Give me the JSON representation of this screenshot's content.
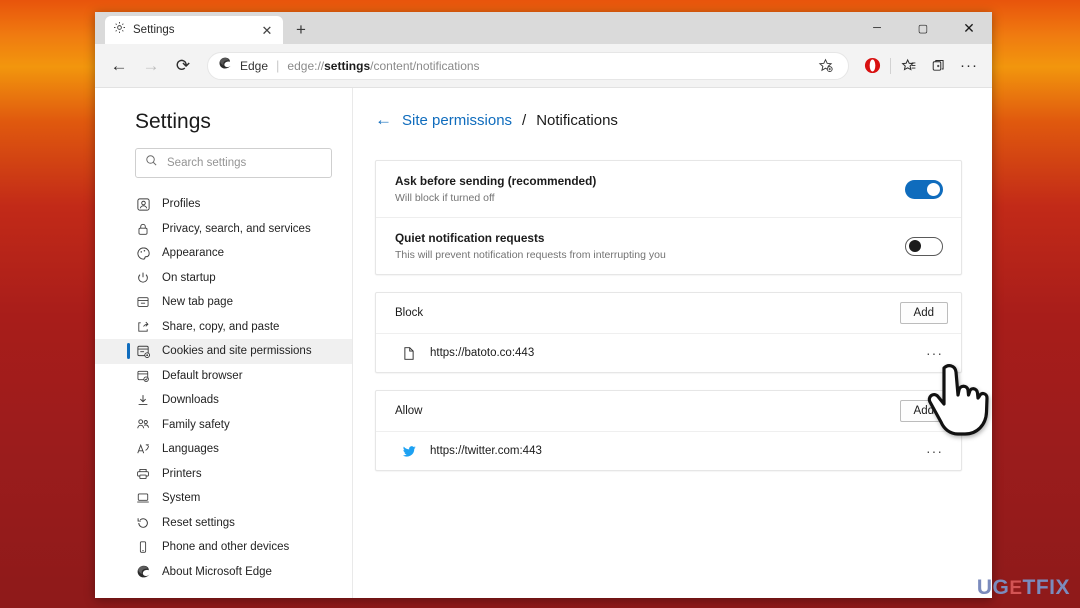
{
  "window": {
    "tab": {
      "title": "Settings",
      "icon": "gear-icon",
      "close": "✕"
    },
    "new_tab_label": "+",
    "controls": {
      "minimize": "─",
      "maximize": "▢",
      "close": "✕"
    }
  },
  "toolbar": {
    "back": "←",
    "forward": "→",
    "reload": "⟳",
    "omnibox": {
      "brand": "Edge",
      "separator": "|",
      "url_prefix": "edge://",
      "url_bold": "settings",
      "url_suffix": "/content/notifications",
      "favorite_icon": "star-add-icon"
    },
    "icons": [
      {
        "name": "opera-extension-icon",
        "color": "#d81111"
      },
      {
        "name": "collections-icon"
      },
      {
        "name": "tab-groups-icon"
      },
      {
        "name": "more-options-icon",
        "glyph": "···"
      }
    ]
  },
  "sidebar": {
    "title": "Settings",
    "search": {
      "placeholder": "Search settings",
      "value": "",
      "icon": "search-icon"
    },
    "items": [
      {
        "label": "Profiles",
        "icon": "profile-icon",
        "selected": false
      },
      {
        "label": "Privacy, search, and services",
        "icon": "lock-icon",
        "selected": false
      },
      {
        "label": "Appearance",
        "icon": "palette-icon",
        "selected": false
      },
      {
        "label": "On startup",
        "icon": "power-icon",
        "selected": false
      },
      {
        "label": "New tab page",
        "icon": "new-tab-page-icon",
        "selected": false
      },
      {
        "label": "Share, copy, and paste",
        "icon": "share-icon",
        "selected": false
      },
      {
        "label": "Cookies and site permissions",
        "icon": "cookies-icon",
        "selected": true
      },
      {
        "label": "Default browser",
        "icon": "default-browser-icon",
        "selected": false
      },
      {
        "label": "Downloads",
        "icon": "download-icon",
        "selected": false
      },
      {
        "label": "Family safety",
        "icon": "family-icon",
        "selected": false
      },
      {
        "label": "Languages",
        "icon": "languages-icon",
        "selected": false
      },
      {
        "label": "Printers",
        "icon": "printer-icon",
        "selected": false
      },
      {
        "label": "System",
        "icon": "system-icon",
        "selected": false
      },
      {
        "label": "Reset settings",
        "icon": "reset-icon",
        "selected": false
      },
      {
        "label": "Phone and other devices",
        "icon": "phone-icon",
        "selected": false
      },
      {
        "label": "About Microsoft Edge",
        "icon": "edge-icon",
        "selected": false
      }
    ]
  },
  "main": {
    "breadcrumb": {
      "back_arrow": "←",
      "parent": "Site permissions",
      "separator": "/",
      "current": "Notifications"
    },
    "settings": [
      {
        "label": "Ask before sending (recommended)",
        "sublabel": "Will block if turned off",
        "toggle": "on"
      },
      {
        "label": "Quiet notification requests",
        "sublabel": "This will prevent notification requests from interrupting you",
        "toggle": "off"
      }
    ],
    "block_section": {
      "title": "Block",
      "add_label": "Add",
      "sites": [
        {
          "url": "https://batoto.co:443",
          "icon": "document-icon",
          "more": "···"
        }
      ]
    },
    "allow_section": {
      "title": "Allow",
      "add_label": "Add",
      "sites": [
        {
          "url": "https://twitter.com:443",
          "icon": "twitter-icon",
          "more": "···"
        }
      ]
    }
  },
  "watermark": {
    "part1": "UG",
    "part2": "E",
    "part3": "TFIX"
  },
  "colors": {
    "accent": "#0f6cbd",
    "toggle_on": "#0f6cbd",
    "twitter_blue": "#1da1f2",
    "extension_red": "#d81111"
  }
}
